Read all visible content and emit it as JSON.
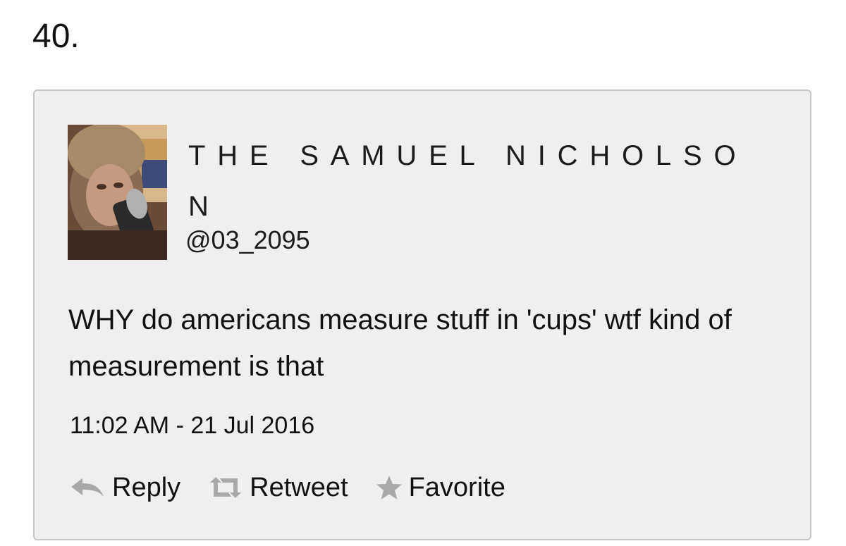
{
  "item_number": "40.",
  "tweet": {
    "display_name": "THE SAMUEL NICHOLSON",
    "handle": "@03_2095",
    "text": "WHY do americans measure stuff in 'cups' wtf kind of measurement is that",
    "timestamp": "11:02 AM - 21 Jul 2016",
    "avatar_icon": "profile-photo"
  },
  "actions": {
    "reply": {
      "label": "Reply",
      "icon": "reply-arrow-icon"
    },
    "retweet": {
      "label": "Retweet",
      "icon": "retweet-icon"
    },
    "favorite": {
      "label": "Favorite",
      "icon": "star-icon"
    }
  },
  "colors": {
    "card_background": "#efefef",
    "card_border": "#c8c8c8",
    "text": "#111111",
    "icon_gray": "#a9a9a9"
  }
}
